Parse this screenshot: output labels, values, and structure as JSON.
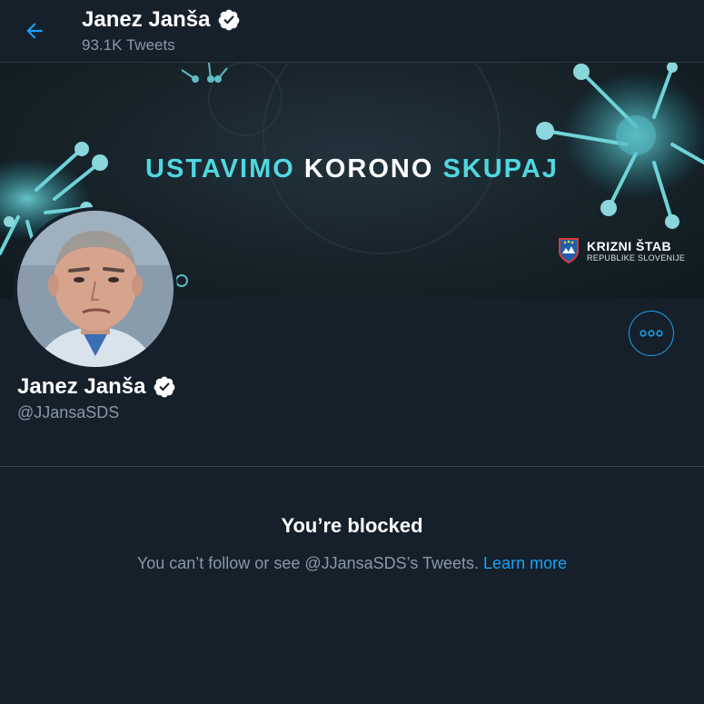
{
  "header": {
    "title": "Janez Janša",
    "tweet_count": "93.1K Tweets",
    "back_icon": "arrow-left-icon"
  },
  "banner": {
    "slogan_part1": "USTAVIMO",
    "slogan_part2": "KORONO",
    "slogan_part3": "SKUPAJ",
    "org_name": "KRIZNI ŠTAB",
    "org_sub": "REPUBLIKE SLOVENIJE"
  },
  "profile": {
    "name": "Janez Janša",
    "handle": "@JJansaSDS",
    "verified_icon": "verified-badge-icon",
    "more_icon": "more-options-icon"
  },
  "blocked": {
    "title": "You’re blocked",
    "message": "You can’t follow or see @JJansaSDS’s Tweets.",
    "link": "Learn more"
  },
  "colors": {
    "background": "#15202b",
    "accent": "#1da1f2",
    "secondary_text": "#8899a6",
    "banner_cyan": "#4fd8e0"
  }
}
